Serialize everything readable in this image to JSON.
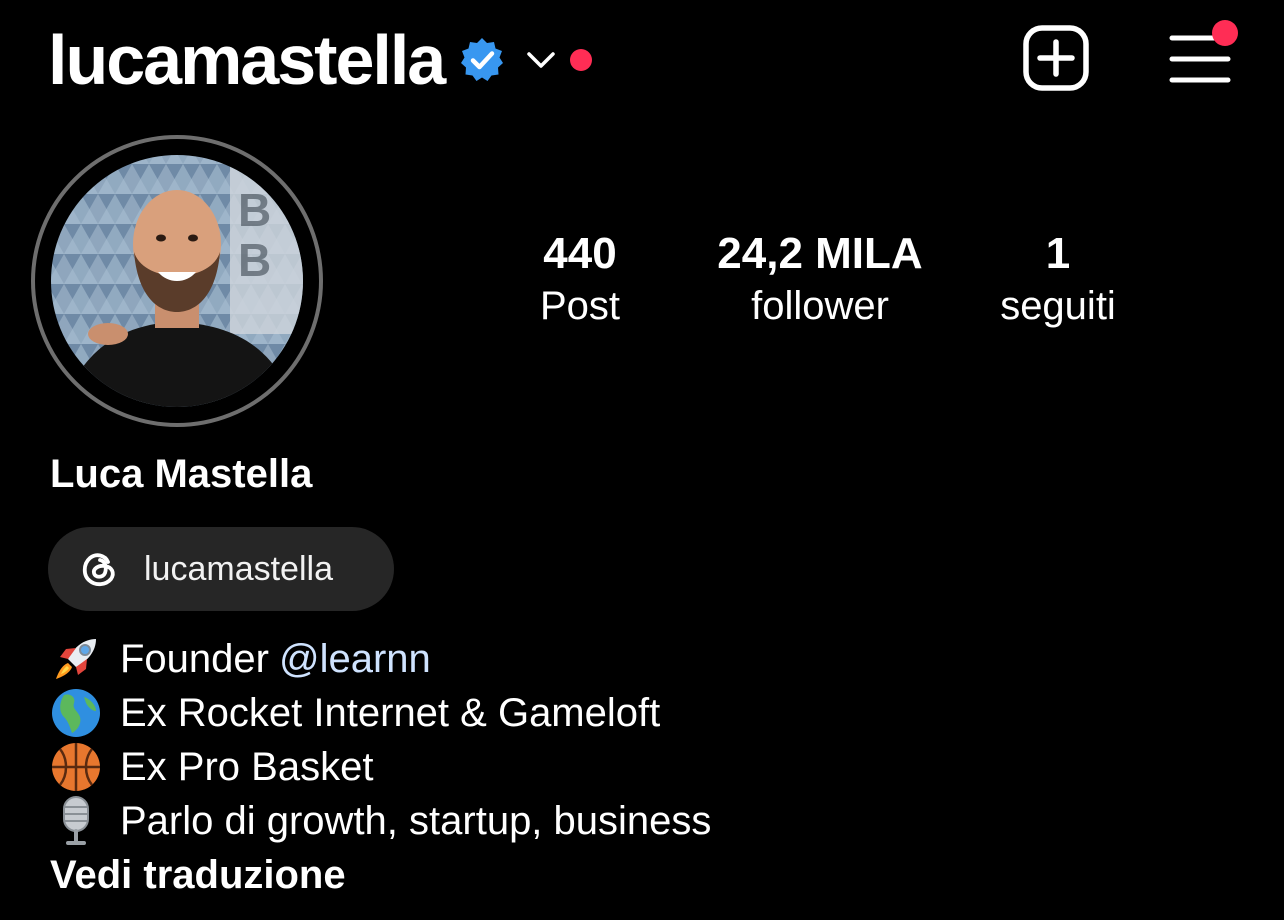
{
  "header": {
    "username": "lucamastella",
    "verified_icon": "verified-badge-icon",
    "dropdown_icon": "chevron-down-icon",
    "new_post_icon": "plus-square-icon",
    "menu_icon": "hamburger-menu-icon",
    "notification_color": "#ff2d55"
  },
  "stats": {
    "posts": {
      "value": "440",
      "label": "Post"
    },
    "followers": {
      "value": "24,2 MILA",
      "label": "follower"
    },
    "following": {
      "value": "1",
      "label": "seguiti"
    }
  },
  "profile": {
    "full_name": "Luca Mastella",
    "threads_handle": "lucamastella",
    "bio": [
      {
        "emoji_icon": "rocket-icon",
        "text": "Founder",
        "mention": "@learnn"
      },
      {
        "emoji_icon": "globe-icon",
        "text": "Ex Rocket Internet & Gameloft"
      },
      {
        "emoji_icon": "basketball-icon",
        "text": "Ex Pro Basket"
      },
      {
        "emoji_icon": "microphone-icon",
        "text": "Parlo di growth, startup, business"
      }
    ],
    "translate_label": "Vedi traduzione"
  },
  "colors": {
    "background": "#000000",
    "chip_background": "#262626",
    "verified_blue": "#3897f0",
    "mention": "#cfe3ff"
  }
}
